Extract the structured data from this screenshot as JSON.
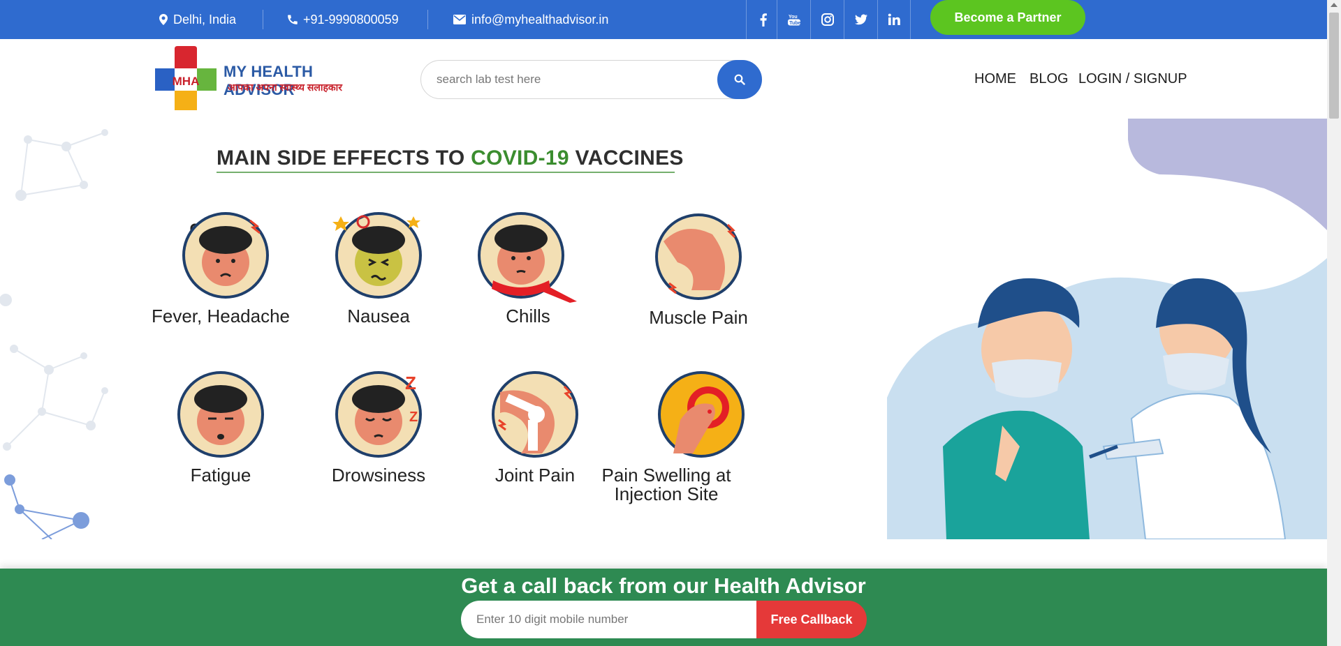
{
  "topbar": {
    "location": "Delhi, India",
    "phone": "+91-9990800059",
    "email": "info@myhealthadvisor.in",
    "partner_label": "Become a Partner",
    "social_icons": [
      "facebook-icon",
      "youtube-icon",
      "instagram-icon",
      "twitter-icon",
      "linkedin-icon"
    ]
  },
  "header": {
    "logo_initials": "MHA",
    "brand": "MY HEALTH ADVISOR",
    "tagline": "आपका अपना स्वास्थ्य सलाहकार",
    "search_placeholder": "search lab test here",
    "nav": [
      "HOME",
      "BLOG",
      "LOGIN / SIGNUP"
    ]
  },
  "hero": {
    "title_part1": "MAIN SIDE EFFECTS TO ",
    "title_highlight": "COVID-19",
    "title_part2": " VACCINES",
    "effects": [
      "Fever, Headache",
      "Nausea",
      "Chills",
      "Muscle Pain",
      "Fatigue",
      "Drowsiness",
      "Joint Pain",
      "Pain Swelling at Injection Site"
    ]
  },
  "callback": {
    "title": "Get a call back from our Health Advisor",
    "placeholder": "Enter 10 digit mobile number",
    "button_label": "Free Callback"
  },
  "colors": {
    "topbar": "#2f6bcf",
    "partner": "#5cc520",
    "callback_bg": "#2e8a52",
    "callback_btn": "#e53939",
    "title_green": "#3b8d2f"
  }
}
